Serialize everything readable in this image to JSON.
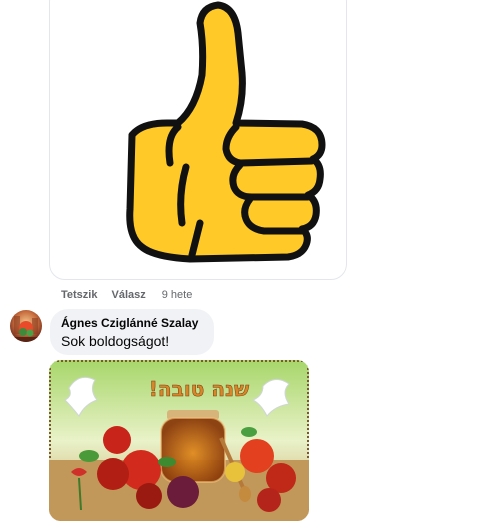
{
  "comment_actions": {
    "like_label": "Tetszik",
    "reply_label": "Válasz",
    "timestamp": "9 hete"
  },
  "comment": {
    "author": "Ágnes Cziglánné Szalay",
    "text": "Sok boldogságot!"
  },
  "greeting_image": {
    "hebrew_greeting": "שנה טובה!"
  },
  "icons": {
    "sticker": "thumbs-up-icon"
  },
  "colors": {
    "thumb_fill": "#ffc928",
    "bubble_bg": "#f0f2f5",
    "meta_text": "#65676b"
  }
}
